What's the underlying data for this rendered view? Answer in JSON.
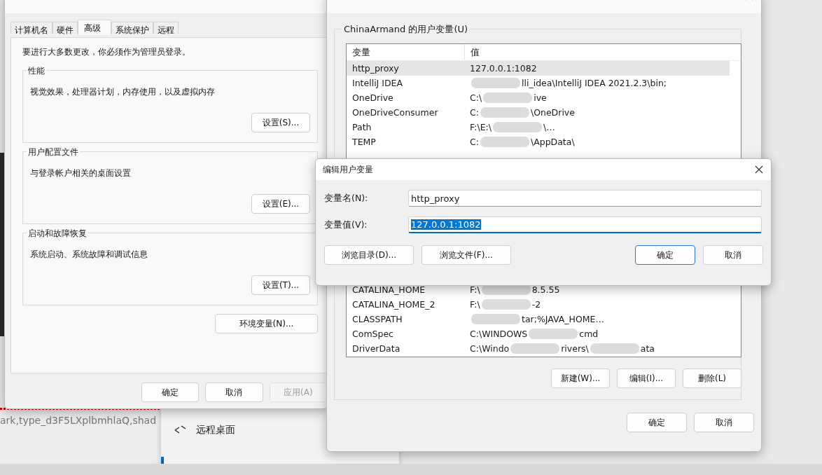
{
  "background": {
    "browser_text": "ark,type_d3F5LXplbmhlaQ,shad",
    "settings_item": "远程桌面"
  },
  "system_properties": {
    "tabs": [
      {
        "label": "计算机名",
        "selected": false
      },
      {
        "label": "硬件",
        "selected": false
      },
      {
        "label": "高级",
        "selected": true
      },
      {
        "label": "系统保护",
        "selected": false
      },
      {
        "label": "远程",
        "selected": false
      }
    ],
    "notice": "要进行大多数更改，你必须作为管理员登录。",
    "groups": [
      {
        "title": "性能",
        "description": "视觉效果，处理器计划，内存使用，以及虚拟内存",
        "button": "设置(S)..."
      },
      {
        "title": "用户配置文件",
        "description": "与登录帐户相关的桌面设置",
        "button": "设置(E)..."
      },
      {
        "title": "启动和故障恢复",
        "description": "系统启动、系统故障和调试信息",
        "button": "设置(T)..."
      }
    ],
    "env_button": "环境变量(N)...",
    "buttons": [
      {
        "label": "确定",
        "disabled": false
      },
      {
        "label": "取消",
        "disabled": false
      },
      {
        "label": "应用(A)",
        "disabled": true
      }
    ]
  },
  "environment_variables": {
    "group_title": "ChinaArmand 的用户变量(U)",
    "columns": [
      "变量",
      "值"
    ],
    "rows_top": [
      {
        "name": "http_proxy",
        "selected": true,
        "value": [
          {
            "kind": "text",
            "text": "127.0.0.1:1082"
          }
        ]
      },
      {
        "name": "IntelliJ IDEA",
        "selected": false,
        "value": [
          {
            "kind": "redaction"
          },
          {
            "kind": "text",
            "text": "lli_idea\\IntelliJ IDEA 2021.2.3\\bin;"
          }
        ]
      },
      {
        "name": "OneDrive",
        "selected": false,
        "value": [
          {
            "kind": "text",
            "text": "C:\\"
          },
          {
            "kind": "redaction"
          },
          {
            "kind": "text",
            "text": "ive"
          }
        ]
      },
      {
        "name": "OneDriveConsumer",
        "selected": false,
        "value": [
          {
            "kind": "text",
            "text": "C:"
          },
          {
            "kind": "redaction"
          },
          {
            "kind": "text",
            "text": "\\OneDrive"
          }
        ]
      },
      {
        "name": "Path",
        "selected": false,
        "value": [
          {
            "kind": "text",
            "text": "F:\\E:\\"
          },
          {
            "kind": "redaction"
          },
          {
            "kind": "text",
            "text": "\\…"
          }
        ]
      },
      {
        "name": "TEMP",
        "selected": false,
        "value": [
          {
            "kind": "text",
            "text": "C:"
          },
          {
            "kind": "redaction"
          },
          {
            "kind": "text",
            "text": "\\AppData\\"
          }
        ]
      }
    ],
    "rows_bottom": [
      {
        "name": "CATALINA_HOME",
        "selected": false,
        "value": [
          {
            "kind": "text",
            "text": "F:\\"
          },
          {
            "kind": "redaction"
          },
          {
            "kind": "text",
            "text": "8.5.55"
          }
        ]
      },
      {
        "name": "CATALINA_HOME_2",
        "selected": false,
        "value": [
          {
            "kind": "text",
            "text": "F:\\"
          },
          {
            "kind": "redaction"
          },
          {
            "kind": "text",
            "text": "-2"
          }
        ]
      },
      {
        "name": "CLASSPATH",
        "selected": false,
        "value": [
          {
            "kind": "redaction"
          },
          {
            "kind": "text",
            "text": "tar;%JAVA_HOME…"
          }
        ]
      },
      {
        "name": "ComSpec",
        "selected": false,
        "value": [
          {
            "kind": "text",
            "text": "C:\\WINDOWS"
          },
          {
            "kind": "redaction"
          },
          {
            "kind": "text",
            "text": "cmd"
          }
        ]
      },
      {
        "name": "DriverData",
        "selected": false,
        "value": [
          {
            "kind": "text",
            "text": "C:\\Windo"
          },
          {
            "kind": "redaction"
          },
          {
            "kind": "text",
            "text": "rivers\\"
          },
          {
            "kind": "redaction"
          },
          {
            "kind": "text",
            "text": "ata"
          }
        ]
      }
    ],
    "row_buttons": [
      "新建(W)...",
      "编辑(I)...",
      "删除(L)"
    ],
    "buttons": [
      "确定",
      "取消"
    ]
  },
  "edit_dialog": {
    "title": "编辑用户变量",
    "fields": [
      {
        "label": "变量名(N):",
        "value": "http_proxy",
        "selected": false
      },
      {
        "label": "变量值(V):",
        "value": "127.0.0.1:1082",
        "selected": true
      }
    ],
    "buttons": [
      {
        "label": "浏览目录(D)...",
        "default": false
      },
      {
        "label": "浏览文件(F)...",
        "default": false
      },
      {
        "label": "确定",
        "default": true
      },
      {
        "label": "取消",
        "default": false
      }
    ]
  }
}
